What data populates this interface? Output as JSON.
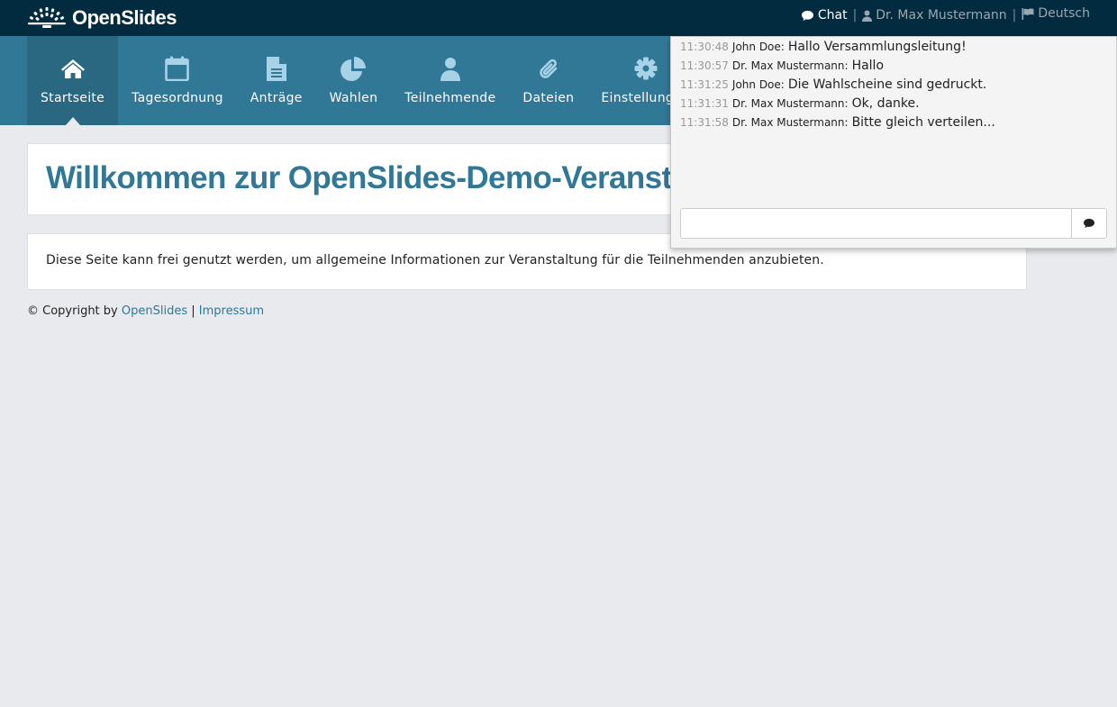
{
  "brand": {
    "name": "OpenSlides"
  },
  "topbar": {
    "chat_label": "Chat",
    "separator": "|",
    "user_name": "Dr. Max Mustermann",
    "language": "Deutsch"
  },
  "nav": {
    "items": [
      {
        "label": "Startseite",
        "icon": "home-icon",
        "active": true
      },
      {
        "label": "Tagesordnung",
        "icon": "calendar-icon"
      },
      {
        "label": "Anträge",
        "icon": "file-text-icon"
      },
      {
        "label": "Wahlen",
        "icon": "pie-chart-icon"
      },
      {
        "label": "Teilnehmende",
        "icon": "user-icon"
      },
      {
        "label": "Dateien",
        "icon": "paperclip-icon"
      },
      {
        "label": "Einstellungen",
        "icon": "gear-icon"
      }
    ]
  },
  "main": {
    "title": "Willkommen zur OpenSlides-Demo-Veranstaltung",
    "text": "Diese Seite kann frei genutzt werden, um allgemeine Informationen zur Veranstaltung für die Teilnehmenden anzubieten."
  },
  "footer": {
    "copyright": "© Copyright by",
    "openslides_link": "OpenSlides",
    "separator": "|",
    "impressum_link": "Impressum"
  },
  "chat": {
    "messages": [
      {
        "time": "11:30:48",
        "author": "John Doe:",
        "text": "Hallo Versammlungsleitung!"
      },
      {
        "time": "11:30:57",
        "author": "Dr. Max Mustermann:",
        "text": "Hallo"
      },
      {
        "time": "11:31:25",
        "author": "John Doe:",
        "text": "Die Wahlscheine sind gedruckt."
      },
      {
        "time": "11:31:31",
        "author": "Dr. Max Mustermann:",
        "text": "Ok, danke."
      },
      {
        "time": "11:31:58",
        "author": "Dr. Max Mustermann:",
        "text": "Bitte gleich verteilen..."
      }
    ],
    "input_value": ""
  },
  "colors": {
    "topbar": "#032b3f",
    "navbar": "#317796",
    "nav_active": "#2a6882",
    "accent": "#317796",
    "background": "#e8eaee"
  }
}
